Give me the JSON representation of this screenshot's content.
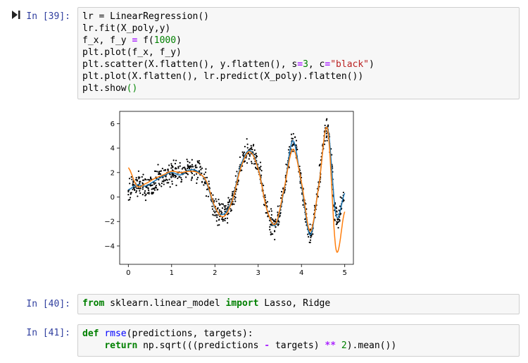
{
  "cells": [
    {
      "prompt": "In [39]:",
      "lines": [
        [
          {
            "t": "lr = LinearRegression()",
            "c": ""
          }
        ],
        [
          {
            "t": "lr.fit(X_poly,y)",
            "c": ""
          }
        ],
        [
          {
            "t": "f_x, f_y ",
            "c": ""
          },
          {
            "t": "=",
            "c": "op"
          },
          {
            "t": " f(",
            "c": ""
          },
          {
            "t": "1000",
            "c": "num"
          },
          {
            "t": ")",
            "c": ""
          }
        ],
        [
          {
            "t": "plt.plot(f_x, f_y)",
            "c": ""
          }
        ],
        [
          {
            "t": "plt.scatter(X.flatten(), y.flatten(), s",
            "c": ""
          },
          {
            "t": "=",
            "c": "op"
          },
          {
            "t": "3",
            "c": "num"
          },
          {
            "t": ", c",
            "c": ""
          },
          {
            "t": "=",
            "c": "op"
          },
          {
            "t": "\"black\"",
            "c": "str"
          },
          {
            "t": ")",
            "c": ""
          }
        ],
        [
          {
            "t": "plt.plot(X.flatten(), lr.predict(X_poly).flatten())",
            "c": ""
          }
        ],
        [
          {
            "t": "plt.show",
            "c": ""
          },
          {
            "t": "()",
            "c": "par"
          }
        ]
      ]
    },
    {
      "prompt": "In [40]:",
      "lines": [
        [
          {
            "t": "from",
            "c": "kw"
          },
          {
            "t": " sklearn.linear_model ",
            "c": ""
          },
          {
            "t": "import",
            "c": "kw"
          },
          {
            "t": " Lasso, Ridge",
            "c": ""
          }
        ]
      ]
    },
    {
      "prompt": "In [41]:",
      "lines": [
        [
          {
            "t": "def",
            "c": "kw"
          },
          {
            "t": " ",
            "c": ""
          },
          {
            "t": "rmse",
            "c": "fn"
          },
          {
            "t": "(predictions, targets):",
            "c": ""
          }
        ],
        [
          {
            "t": "    ",
            "c": ""
          },
          {
            "t": "return",
            "c": "kw"
          },
          {
            "t": " np.sqrt(((predictions ",
            "c": ""
          },
          {
            "t": "-",
            "c": "op"
          },
          {
            "t": " targets) ",
            "c": ""
          },
          {
            "t": "**",
            "c": "op"
          },
          {
            "t": " ",
            "c": ""
          },
          {
            "t": "2",
            "c": "num"
          },
          {
            "t": ").mean())",
            "c": ""
          }
        ]
      ]
    }
  ],
  "icons": {
    "run": "run-cell-icon"
  },
  "chart_data": {
    "type": "line",
    "xlim": [
      -0.2,
      5.2
    ],
    "ylim": [
      -5.5,
      7.0
    ],
    "xticks": [
      "0",
      "1",
      "2",
      "3",
      "4",
      "5"
    ],
    "yticks": [
      "6",
      "4",
      "2",
      "0",
      "−2",
      "−4"
    ],
    "grid": false,
    "series": [
      {
        "color": "#1f77b4",
        "x": [
          0,
          0.2,
          0.4,
          0.6,
          0.8,
          1.0,
          1.2,
          1.4,
          1.6,
          1.8,
          2.0,
          2.2,
          2.4,
          2.6,
          2.8,
          3.0,
          3.2,
          3.4,
          3.6,
          3.8,
          4.0,
          4.2,
          4.4,
          4.6,
          4.8,
          5.0
        ],
        "y": [
          0.6,
          1.0,
          0.9,
          1.3,
          1.7,
          2.0,
          1.8,
          2.2,
          2.1,
          1.2,
          -0.9,
          -1.4,
          -0.2,
          2.6,
          3.8,
          2.4,
          -1.0,
          -2.3,
          0.6,
          4.6,
          1.0,
          -3.1,
          1.0,
          5.7,
          -1.5,
          0.3
        ]
      },
      {
        "color": "#ff7f0e",
        "x": [
          0,
          0.2,
          0.4,
          0.6,
          0.8,
          1.0,
          1.2,
          1.4,
          1.6,
          1.8,
          2.0,
          2.2,
          2.4,
          2.6,
          2.8,
          3.0,
          3.2,
          3.4,
          3.6,
          3.8,
          4.0,
          4.2,
          4.4,
          4.6,
          4.8,
          5.0
        ],
        "y": [
          2.4,
          0.9,
          1.1,
          1.5,
          1.8,
          2.1,
          2.0,
          2.1,
          2.0,
          1.3,
          -0.8,
          -1.6,
          -0.3,
          2.4,
          3.7,
          2.3,
          -1.0,
          -2.2,
          0.7,
          3.9,
          1.2,
          -2.8,
          0.9,
          5.6,
          -4.3,
          -1.2
        ]
      }
    ],
    "scatter": {
      "color": "#000000",
      "noise": 0.45,
      "count": 900
    }
  }
}
